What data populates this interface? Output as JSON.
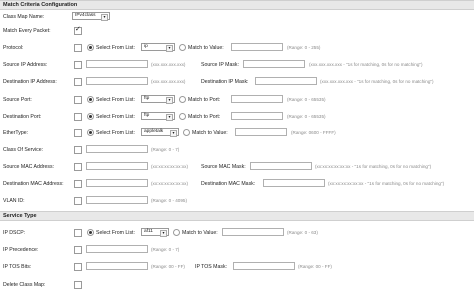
{
  "section_match": "Match Criteria Configuration",
  "section_service": "Service Type",
  "class_map_name": {
    "label": "Class Map Name:",
    "value": "IPv4class"
  },
  "match_every_packet": {
    "label": "Match Every Packet:",
    "checked": true
  },
  "protocol": {
    "label": "Protocol:",
    "select_from_list": "Select From List:",
    "selected": "ip",
    "match_to_value": "Match to Value:",
    "hint": "(Range: 0 - 255)"
  },
  "source_ip": {
    "label": "Source IP Address:",
    "placeholder": "(xxx.xxx.xxx.xxx)",
    "mask_label": "Source IP Mask:",
    "mask_hint": "(xxx.xxx.xxx.xxx - \"1s for matching, 0s for no matching\")"
  },
  "dest_ip": {
    "label": "Destination IP Address:",
    "placeholder": "(xxx.xxx.xxx.xxx)",
    "mask_label": "Destination IP Mask:",
    "mask_hint": "(xxx.xxx.xxx.xxx - \"1s for matching, 0s for no matching\")"
  },
  "source_port": {
    "label": "Source Port:",
    "select_from_list": "Select From List:",
    "selected": "ftp",
    "match_to_value": "Match to Port:",
    "hint": "(Range: 0 - 65535)"
  },
  "dest_port": {
    "label": "Destination Port:",
    "select_from_list": "Select From List:",
    "selected": "ftp",
    "match_to_value": "Match to Port:",
    "hint": "(Range: 0 - 65535)"
  },
  "ethertype": {
    "label": "EtherType:",
    "select_from_list": "Select From List:",
    "selected": "appletalk",
    "match_to_value": "Match to Value:",
    "hint": "(Range: 0600 - FFFF)"
  },
  "class_of_service": {
    "label": "Class Of Service:",
    "hint": "(Range: 0 - 7)"
  },
  "source_mac": {
    "label": "Source MAC Address:",
    "placeholder": "(xx:xx:xx:xx:xx:xx)",
    "mask_label": "Source MAC Mask:",
    "mask_hint": "(xx:xx:xx:xx:xx:xx - \"1s for matching, 0s for no matching\")"
  },
  "dest_mac": {
    "label": "Destination MAC Address:",
    "placeholder": "(xx:xx:xx:xx:xx:xx)",
    "mask_label": "Destination MAC Mask:",
    "mask_hint": "(xx:xx:xx:xx:xx:xx - \"1s for matching, 0s for no matching\")"
  },
  "vlan_id": {
    "label": "VLAN ID:",
    "hint": "(Range: 0 - 4095)"
  },
  "ip_dscp": {
    "label": "IP DSCP:",
    "select_from_list": "Select From List:",
    "selected": "af11",
    "match_to_value": "Match to Value:",
    "hint": "(Range: 0 - 63)"
  },
  "ip_precedence": {
    "label": "IP Precedence:",
    "hint": "(Range: 0 - 7)"
  },
  "ip_tos_bits": {
    "label": "IP TOS Bits:",
    "hint": "(Range: 00 - FF)",
    "mask_label": "IP TOS Mask:",
    "mask_hint": "(Range: 00 - FF)"
  },
  "delete_class_map": {
    "label": "Delete Class Map:"
  }
}
